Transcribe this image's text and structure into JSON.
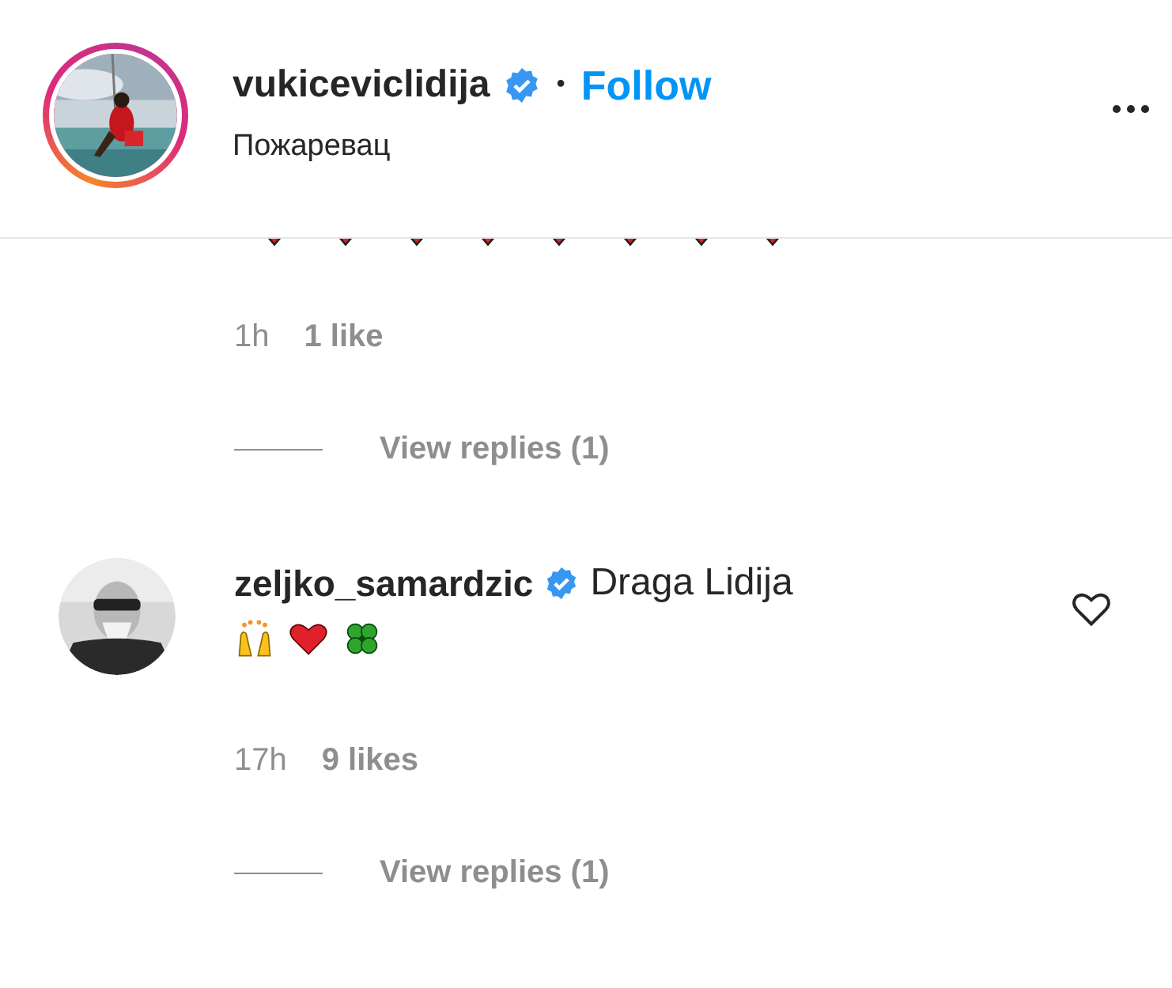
{
  "header": {
    "username": "vukiceviclidija",
    "verified": true,
    "separator": "•",
    "follow": "Follow",
    "location": "Пожаревац"
  },
  "comments": [
    {
      "kind": "cut",
      "time": "1h",
      "likes": "1 like",
      "replies": "View replies (1)"
    },
    {
      "kind": "full",
      "username": "zeljko_samardzic",
      "verified": true,
      "text": "Draga Lidija",
      "liked": false,
      "time": "17h",
      "likes": "9 likes",
      "replies": "View replies (1)"
    }
  ]
}
